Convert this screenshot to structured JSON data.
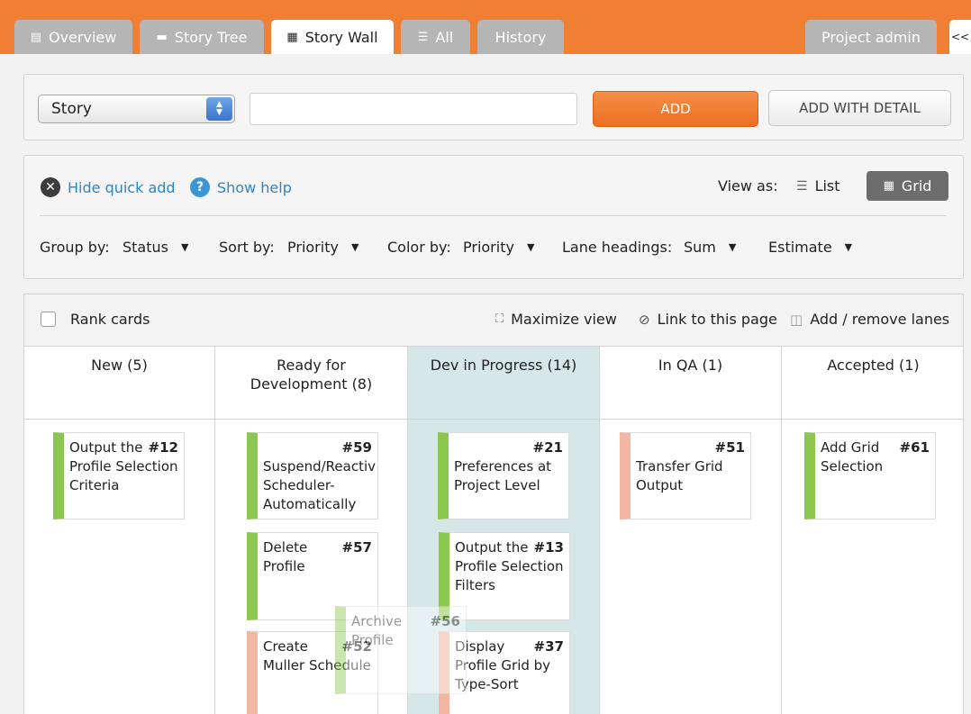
{
  "tabs": [
    {
      "label": "Overview",
      "icon": "document-icon",
      "glyph": "▤"
    },
    {
      "label": "Story Tree",
      "icon": "tree-icon",
      "glyph": "▬"
    },
    {
      "label": "Story Wall",
      "icon": "grid-icon",
      "glyph": "▦"
    },
    {
      "label": "All",
      "icon": "list-icon",
      "glyph": "☰"
    },
    {
      "label": "History",
      "icon": "",
      "glyph": ""
    },
    {
      "label": "Project admin",
      "icon": "",
      "glyph": ""
    },
    {
      "label": "<<",
      "icon": "",
      "glyph": ""
    }
  ],
  "quick_add": {
    "type_value": "Story",
    "input_value": "",
    "add_label": "ADD",
    "add_detail_label": "ADD WITH DETAIL"
  },
  "options": {
    "hide_quick_add": "Hide quick add",
    "show_help": "Show help",
    "view_as": "View as:",
    "list_label": "List",
    "grid_label": "Grid",
    "group_by_label": "Group by:",
    "group_by_value": "Status",
    "sort_by_label": "Sort by:",
    "sort_by_value": "Priority",
    "color_by_label": "Color by:",
    "color_by_value": "Priority",
    "lane_headings_label": "Lane headings:",
    "lane_headings_value": "Sum",
    "estimate_label": "Estimate"
  },
  "toolbar": {
    "rank_cards": "Rank cards",
    "maximize_view": "Maximize view",
    "link_to_page": "Link to this page",
    "add_remove_lanes": "Add / remove lanes"
  },
  "lanes": [
    {
      "title": "New (5)"
    },
    {
      "title": "Ready for Development (8)"
    },
    {
      "title": "Dev in Progress (14)"
    },
    {
      "title": "In QA (1)"
    },
    {
      "title": "Accepted (1)"
    }
  ],
  "cards": [
    {
      "number": "#12",
      "title": "Output the Profile Selection Criteria",
      "color": "#8cc850"
    },
    {
      "number": "#59",
      "title": "Suspend/Reactiv Scheduler-Automatically",
      "color": "#8cc850"
    },
    {
      "number": "#57",
      "title": "Delete Profile",
      "color": "#8cc850"
    },
    {
      "number": "#52",
      "title": "Create Muller Schedule",
      "color": "#f2b6a3"
    },
    {
      "number": "#21",
      "title": "Preferences at Project Level",
      "color": "#8cc850"
    },
    {
      "number": "#13",
      "title": "Output the Profile Selection Filters",
      "color": "#8cc850"
    },
    {
      "number": "#37",
      "title": "Display Profile Grid by Type-Sort",
      "color": "#f2b6a3"
    },
    {
      "number": "#51",
      "title": "Transfer Grid Output",
      "color": "#f2b6a3"
    },
    {
      "number": "#61",
      "title": "Add Grid Selection",
      "color": "#8cc850"
    },
    {
      "number": "#56",
      "title": "Archive Profile",
      "color": "#8cc850"
    }
  ],
  "colors": {
    "brand_orange": "#f07f33",
    "link_blue": "#2d86c8",
    "priority_green": "#8cc850",
    "priority_pink": "#f2b6a3",
    "highlight_lane": "#d6e7e8"
  }
}
